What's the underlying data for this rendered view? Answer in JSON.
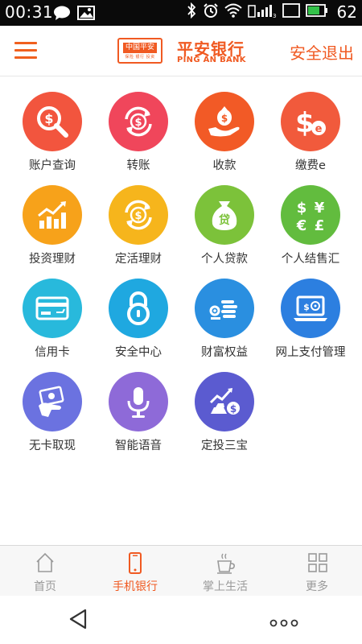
{
  "status_bar": {
    "time": "00:31",
    "battery": "62",
    "sim": "2",
    "network": "3G"
  },
  "header": {
    "logo_badge": "中国平安",
    "logo_sub": "保险 银行 投资",
    "bank_name_cn": "平安银行",
    "bank_name_en": "PING AN BANK",
    "logout_label": "安全退出",
    "accent_color": "#f05a22"
  },
  "services": [
    {
      "label": "账户查询",
      "icon": "search-coin-icon",
      "color": "#f2553e"
    },
    {
      "label": "转账",
      "icon": "transfer-coin-icon",
      "color": "#f0465b"
    },
    {
      "label": "收款",
      "icon": "receive-money-icon",
      "color": "#f25a26"
    },
    {
      "label": "缴费e",
      "icon": "pay-bill-e-icon",
      "color": "#f15a3c"
    },
    {
      "label": "投资理财",
      "icon": "investment-chart-icon",
      "color": "#f7a21a"
    },
    {
      "label": "定活理财",
      "icon": "cycle-coin-icon",
      "color": "#f6b51c"
    },
    {
      "label": "个人贷款",
      "icon": "loan-bag-icon",
      "color": "#7cc23a"
    },
    {
      "label": "个人结售汇",
      "icon": "currency-exchange-icon",
      "color": "#62bc3e"
    },
    {
      "label": "信用卡",
      "icon": "credit-card-icon",
      "color": "#28b9dc"
    },
    {
      "label": "安全中心",
      "icon": "padlock-icon",
      "color": "#1fa8e0"
    },
    {
      "label": "财富权益",
      "icon": "wealth-coins-icon",
      "color": "#2a8fe0"
    },
    {
      "label": "网上支付管理",
      "icon": "laptop-payment-icon",
      "color": "#2c7fe0"
    },
    {
      "label": "无卡取现",
      "icon": "cash-withdraw-icon",
      "color": "#6b72e0"
    },
    {
      "label": "智能语音",
      "icon": "microphone-icon",
      "color": "#8e6ad8"
    },
    {
      "label": "定投三宝",
      "icon": "fixed-investment-icon",
      "color": "#5b5bd0"
    }
  ],
  "tabs": [
    {
      "label": "首页",
      "icon": "home-icon",
      "active": false
    },
    {
      "label": "手机银行",
      "icon": "phone-icon",
      "active": true
    },
    {
      "label": "掌上生活",
      "icon": "coffee-cup-icon",
      "active": false
    },
    {
      "label": "更多",
      "icon": "grid-icon",
      "active": false
    }
  ]
}
